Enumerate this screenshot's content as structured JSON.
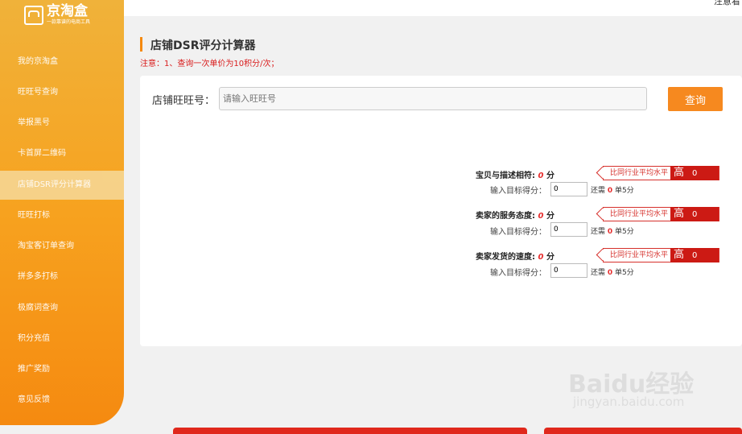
{
  "logo": {
    "name": "京淘盒",
    "tagline": "一款靠谱的电商工具"
  },
  "top_right": "注意看",
  "sidebar": {
    "items": [
      {
        "label": "我的京淘盒"
      },
      {
        "label": "旺旺号查询"
      },
      {
        "label": "举报黑号"
      },
      {
        "label": "卡首屏二维码"
      },
      {
        "label": "店铺DSR评分计算器",
        "active": true
      },
      {
        "label": "旺旺打标"
      },
      {
        "label": "淘宝客订单查询"
      },
      {
        "label": "拼多多打标"
      },
      {
        "label": "极腐词查询"
      },
      {
        "label": "积分充值"
      },
      {
        "label": "推广奖励"
      },
      {
        "label": "意见反馈"
      }
    ]
  },
  "page": {
    "title": "店铺DSR评分计算器",
    "notice": "注意：1、查询一次单价为10积分/次；",
    "ww_label": "店铺旺旺号：",
    "ww_placeholder": "请输入旺旺号",
    "query_label": "查询"
  },
  "metrics": [
    {
      "name": "宝贝与描述相符:",
      "score": "0",
      "unit": "分",
      "target_label": "输入目标得分：",
      "target_value": "0",
      "need_prefix": "还需",
      "need_count": "0",
      "need_suffix": "单5分",
      "compare_text": "比同行业平均水平",
      "level": "高",
      "level_value": "0"
    },
    {
      "name": "卖家的服务态度:",
      "score": "0",
      "unit": "分",
      "target_label": "输入目标得分：",
      "target_value": "0",
      "need_prefix": "还需",
      "need_count": "0",
      "need_suffix": "单5分",
      "compare_text": "比同行业平均水平",
      "level": "高",
      "level_value": "0"
    },
    {
      "name": "卖家发货的速度:",
      "score": "0",
      "unit": "分",
      "target_label": "输入目标得分：",
      "target_value": "0",
      "need_prefix": "还需",
      "need_count": "0",
      "need_suffix": "单5分",
      "compare_text": "比同行业平均水平",
      "level": "高",
      "level_value": "0"
    }
  ],
  "watermark": {
    "brand": "Baidu经验",
    "url": "jingyan.baidu.com"
  },
  "colors": {
    "accent": "#f6891f",
    "alert": "#cc1a14"
  }
}
